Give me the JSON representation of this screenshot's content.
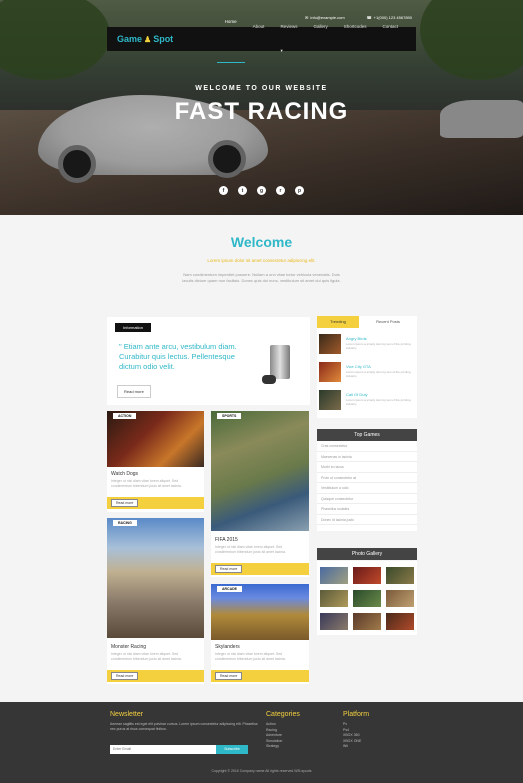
{
  "topbar": {
    "email": "info@example.com",
    "phone": "+1(000) 123 4567890"
  },
  "nav": {
    "logo_text_1": "Game",
    "logo_text_2": "Spot",
    "links": [
      "Home",
      "About",
      "Reviews",
      "Gallery",
      "Shortcodes",
      "Contact"
    ]
  },
  "hero": {
    "subtitle": "WELCOME TO OUR WEBSITE",
    "title": "FAST RACING"
  },
  "welcome": {
    "title": "Welcome",
    "subtitle": "Lorem ipsum dolor sit amet consectetur adipiscing elit.",
    "text": "Nam condimentum imperdiet posuere. Nullam a orci vitae tortor vehicula venenatis. Duis iaculis dictum quam non facilisis. Donec quis dui nunc, vestibulum sit amet dui quis ligula."
  },
  "info": {
    "tag": "Information",
    "quote": "\" Etiam ante arcu, vestibulum diam. Curabitur quis lectus. Pellentesque dictum odio velit.",
    "button": "Read more"
  },
  "cards": [
    {
      "tag": "ACTION",
      "title": "Watch Dogs",
      "text": "Integer ut nisi diam vitae lorem aliquet. Sed condimentum bibendum justo sit amet lacinia.",
      "button": "Read more"
    },
    {
      "tag": "SPORTS",
      "title": "FIFA 2015",
      "text": "Integer ut nisi diam vitae lorem aliquet. Sed condimentum bibendum justo sit amet lacinia.",
      "button": "Read more"
    },
    {
      "tag": "RACING",
      "title": "Monster Racing",
      "text": "Integer ut nisi diam vitae lorem aliquet. Sed condimentum bibendum justo sit amet lacinia.",
      "button": "Read more"
    },
    {
      "tag": "ARCADE",
      "title": "Skylanders",
      "text": "Integer ut nisi diam vitae lorem aliquet. Sed condimentum bibendum justo sit amet lacinia.",
      "button": "Read more"
    }
  ],
  "sidebar": {
    "tabs": [
      "Trending",
      "Recent Posts"
    ],
    "trending": [
      {
        "title": "Angry Birds",
        "text": "Lorem ipsum a simply dummy text of the printing industry."
      },
      {
        "title": "Vice City GTA",
        "text": "Lorem ipsum a simply dummy text of the printing industry."
      },
      {
        "title": "Call Of Duty",
        "text": "Lorem ipsum a simply dummy text of the printing industry."
      }
    ],
    "top_games_title": "Top Games",
    "top_games": [
      "Cras consectetur",
      "Maecenas in lacinia",
      "Morbi eu lacus",
      "Proin ut consectetur at",
      "Vestibulum a odio",
      "Quisque consectetur",
      "Phasellus sodales",
      "Donec id lacinia justo"
    ],
    "gallery_title": "Photo Gallery"
  },
  "footer": {
    "newsletter_title": "Newsletter",
    "newsletter_text": "Aenean sagittis est eget elit pulvinar cursus. Lorem ipsum consectetur adipiscing elit. Phasellus nec purus at risus consequat finibus.",
    "email_placeholder": "Enter Email",
    "subscribe": "Subscribe",
    "categories_title": "Categories",
    "categories": [
      "Action",
      "Racing",
      "Adventure",
      "Simulation",
      "Strategy"
    ],
    "platform_title": "Platform",
    "platform": [
      "Pc",
      "Ps4",
      "XBOX 360",
      "XBOX ONE",
      "Wii"
    ],
    "copyright": "Copyright © 2016 Company name All rights reserved.W3l.ayouts"
  },
  "colors": {
    "accent": "#2fb8c8",
    "yellow": "#f4d03f",
    "dark": "#111111",
    "footer": "#363636"
  }
}
